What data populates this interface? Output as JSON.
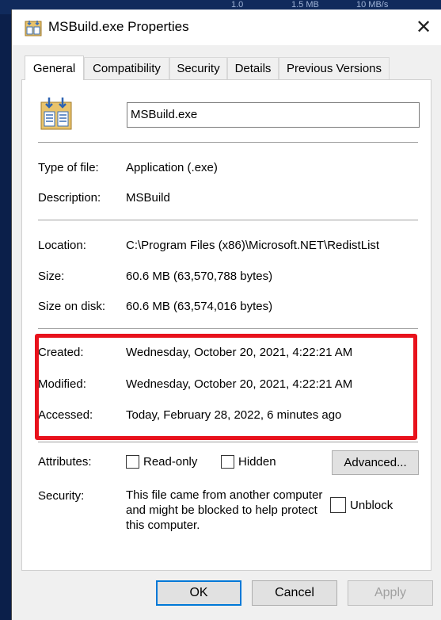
{
  "background": {
    "text_a": "1.0",
    "text_b": "1.5 MB",
    "text_c": "10 MB/s"
  },
  "window": {
    "title": "MSBuild.exe Properties",
    "close_glyph": "✕"
  },
  "tabs": [
    {
      "label": "General",
      "active": true
    },
    {
      "label": "Compatibility",
      "active": false
    },
    {
      "label": "Security",
      "active": false
    },
    {
      "label": "Details",
      "active": false
    },
    {
      "label": "Previous Versions",
      "active": false
    }
  ],
  "general": {
    "file_name": "MSBuild.exe",
    "type_label": "Type of file:",
    "type_value": "Application (.exe)",
    "description_label": "Description:",
    "description_value": "MSBuild",
    "location_label": "Location:",
    "location_value": "C:\\Program Files (x86)\\Microsoft.NET\\RedistList",
    "size_label": "Size:",
    "size_value": "60.6 MB (63,570,788 bytes)",
    "size_on_disk_label": "Size on disk:",
    "size_on_disk_value": "60.6 MB (63,574,016 bytes)",
    "created_label": "Created:",
    "created_value": "Wednesday, October 20, 2021, 4:22:21 AM",
    "modified_label": "Modified:",
    "modified_value": "Wednesday, October 20, 2021, 4:22:21 AM",
    "accessed_label": "Accessed:",
    "accessed_value": "Today, February 28, 2022, 6 minutes ago",
    "attributes_label": "Attributes:",
    "readonly_label": "Read-only",
    "readonly_checked": false,
    "hidden_label": "Hidden",
    "hidden_checked": false,
    "advanced_label": "Advanced...",
    "security_label": "Security:",
    "security_text": "This file came from another computer and might be blocked to help protect this computer.",
    "unblock_label": "Unblock",
    "unblock_checked": false
  },
  "buttons": {
    "ok": "OK",
    "cancel": "Cancel",
    "apply": "Apply"
  },
  "colors": {
    "highlight": "#e8121c",
    "default_button_border": "#0078d7",
    "desktop_bg": "#0b1f4a"
  },
  "icons": {
    "app": "application-file-icon",
    "close": "close-icon"
  }
}
